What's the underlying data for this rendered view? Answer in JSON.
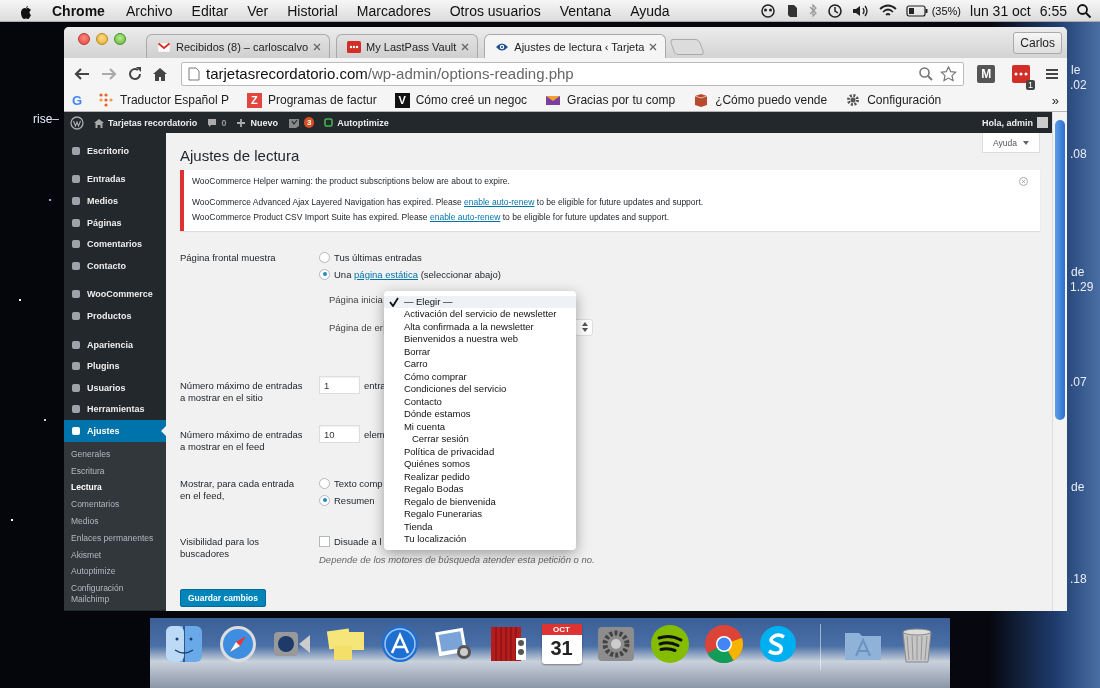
{
  "menubar": {
    "app": "Chrome",
    "items": [
      "Archivo",
      "Editar",
      "Ver",
      "Historial",
      "Marcadores",
      "Otros usuarios",
      "Ventana",
      "Ayuda"
    ],
    "battery": "(35%)",
    "date": "lun 31 oct",
    "time": "6:55"
  },
  "browser": {
    "tabs": [
      {
        "title": "Recibidos (8) – carloscalvo",
        "selected": false
      },
      {
        "title": "My LastPass Vault",
        "selected": false
      },
      {
        "title": "Ajustes de lectura ‹ Tarjeta",
        "selected": true
      }
    ],
    "profile": "Carlos",
    "url_host": "tarjetasrecordatorio.com",
    "url_path": "/wp-admin/options-reading.php",
    "extension_letter": "M",
    "extension_badge": "1",
    "bookmarks": {
      "lead": "G",
      "items": [
        {
          "label": "Traductor Español P"
        },
        {
          "icon_text": "Z",
          "label": "Programas de factur"
        },
        {
          "icon_text": "V",
          "label": "Cómo creé un negoc"
        },
        {
          "label": "Gracias por tu comp"
        },
        {
          "label": "¿Cómo puedo vende"
        },
        {
          "label": "Configuración"
        }
      ],
      "more": "»"
    }
  },
  "admin_bar": {
    "site": "Tarjetas recordatorio",
    "comments": "0",
    "new": "Nuevo",
    "updates": "3",
    "plugin": "Autoptimize",
    "greeting": "Hola, admin"
  },
  "sidebar": {
    "groups": [
      [
        {
          "label": "Escritorio",
          "selected": false
        }
      ],
      [
        {
          "label": "Entradas",
          "selected": false
        },
        {
          "label": "Medios",
          "selected": false
        },
        {
          "label": "Páginas",
          "selected": false
        },
        {
          "label": "Comentarios",
          "selected": false
        },
        {
          "label": "Contacto",
          "selected": false
        }
      ],
      [
        {
          "label": "WooCommerce",
          "selected": false
        },
        {
          "label": "Productos",
          "selected": false
        }
      ],
      [
        {
          "label": "Apariencia",
          "selected": false
        },
        {
          "label": "Plugins",
          "selected": false
        },
        {
          "label": "Usuarios",
          "selected": false
        },
        {
          "label": "Herramientas",
          "selected": false
        },
        {
          "label": "Ajustes",
          "selected": true,
          "children": [
            {
              "label": "Generales",
              "selected": false
            },
            {
              "label": "Escritura",
              "selected": false
            },
            {
              "label": "Lectura",
              "selected": true
            },
            {
              "label": "Comentarios",
              "selected": false
            },
            {
              "label": "Medios",
              "selected": false
            },
            {
              "label": "Enlaces permanentes",
              "selected": false
            },
            {
              "label": "Akismet",
              "selected": false
            },
            {
              "label": "Autoptimize",
              "selected": false
            },
            {
              "label": "Configuración Mailchimp",
              "selected": false
            }
          ]
        }
      ]
    ]
  },
  "page": {
    "title": "Ajustes de lectura",
    "help": "Ayuda",
    "notice": {
      "heading": "WooCommerce Helper warning: the product subscriptions below are about to expire.",
      "lines": [
        {
          "before": "WooCommerce Advanced Ajax Layered Navigation has expired. Please ",
          "link": "enable auto-renew",
          "after": " to be eligible for future updates and support."
        },
        {
          "before": "WooCommerce Product CSV Import Suite has expired. Please ",
          "link": "enable auto-renew",
          "after": " to be eligible for future updates and support."
        }
      ]
    },
    "front_page": {
      "label": "Página frontal muestra",
      "options": [
        {
          "before": "Tus últimas entradas",
          "selected": false
        },
        {
          "before": "Una ",
          "link": "página estática",
          "after": " (seleccionar abajo)",
          "selected": true
        }
      ],
      "home_label": "Página inicia",
      "posts_label": "Página de er"
    },
    "posts_per_page": {
      "label": "Número máximo de entradas a mostrar en el sitio",
      "value": "1",
      "unit": "entra"
    },
    "feed_items": {
      "label": "Número máximo de entradas a mostrar en el feed",
      "value": "10",
      "unit": "elem"
    },
    "feed_content": {
      "label": "Mostrar, para cada entrada en el feed,",
      "options": [
        {
          "label": "Texto comp",
          "selected": false
        },
        {
          "label": "Resumen",
          "selected": true
        }
      ]
    },
    "visibility": {
      "label": "Visibilidad para los buscadores",
      "checkbox_label": "Disuade a l",
      "checked": false,
      "description": "Depende de los motores de búsqueda atender esta petición o no."
    },
    "save": "Guardar cambios"
  },
  "dropdown": {
    "options": [
      {
        "label": "— Elegir —",
        "selected": true
      },
      {
        "label": "Activación del servicio de newsletter",
        "selected": false
      },
      {
        "label": "Alta confirmada a la newsletter",
        "selected": false
      },
      {
        "label": "Bienvenidos a nuestra web",
        "selected": false
      },
      {
        "label": "Borrar",
        "selected": false
      },
      {
        "label": "Carro",
        "selected": false
      },
      {
        "label": "Cómo comprar",
        "selected": false
      },
      {
        "label": "Condiciones del servicio",
        "selected": false
      },
      {
        "label": "Contacto",
        "selected": false
      },
      {
        "label": "Dónde estamos",
        "selected": false
      },
      {
        "label": "Mi cuenta",
        "selected": false,
        "children": [
          {
            "label": "Cerrar sesión",
            "selected": false
          }
        ]
      },
      {
        "label": "Política de privacidad",
        "selected": false
      },
      {
        "label": "Quiénes somos",
        "selected": false
      },
      {
        "label": "Realizar pedido",
        "selected": false
      },
      {
        "label": "Regalo Bodas",
        "selected": false
      },
      {
        "label": "Regalo de bienvenida",
        "selected": false
      },
      {
        "label": "Regalo Funerarias",
        "selected": false
      },
      {
        "label": "Tienda",
        "selected": false
      },
      {
        "label": "Tu localización",
        "selected": false
      }
    ]
  },
  "dock": {
    "calendar_month": "OCT",
    "calendar_day": "31"
  },
  "desktop_fragments": [
    "rise–",
    "le",
    ".02",
    ".08",
    "de",
    "1.29",
    ".07",
    "de",
    ".18"
  ]
}
